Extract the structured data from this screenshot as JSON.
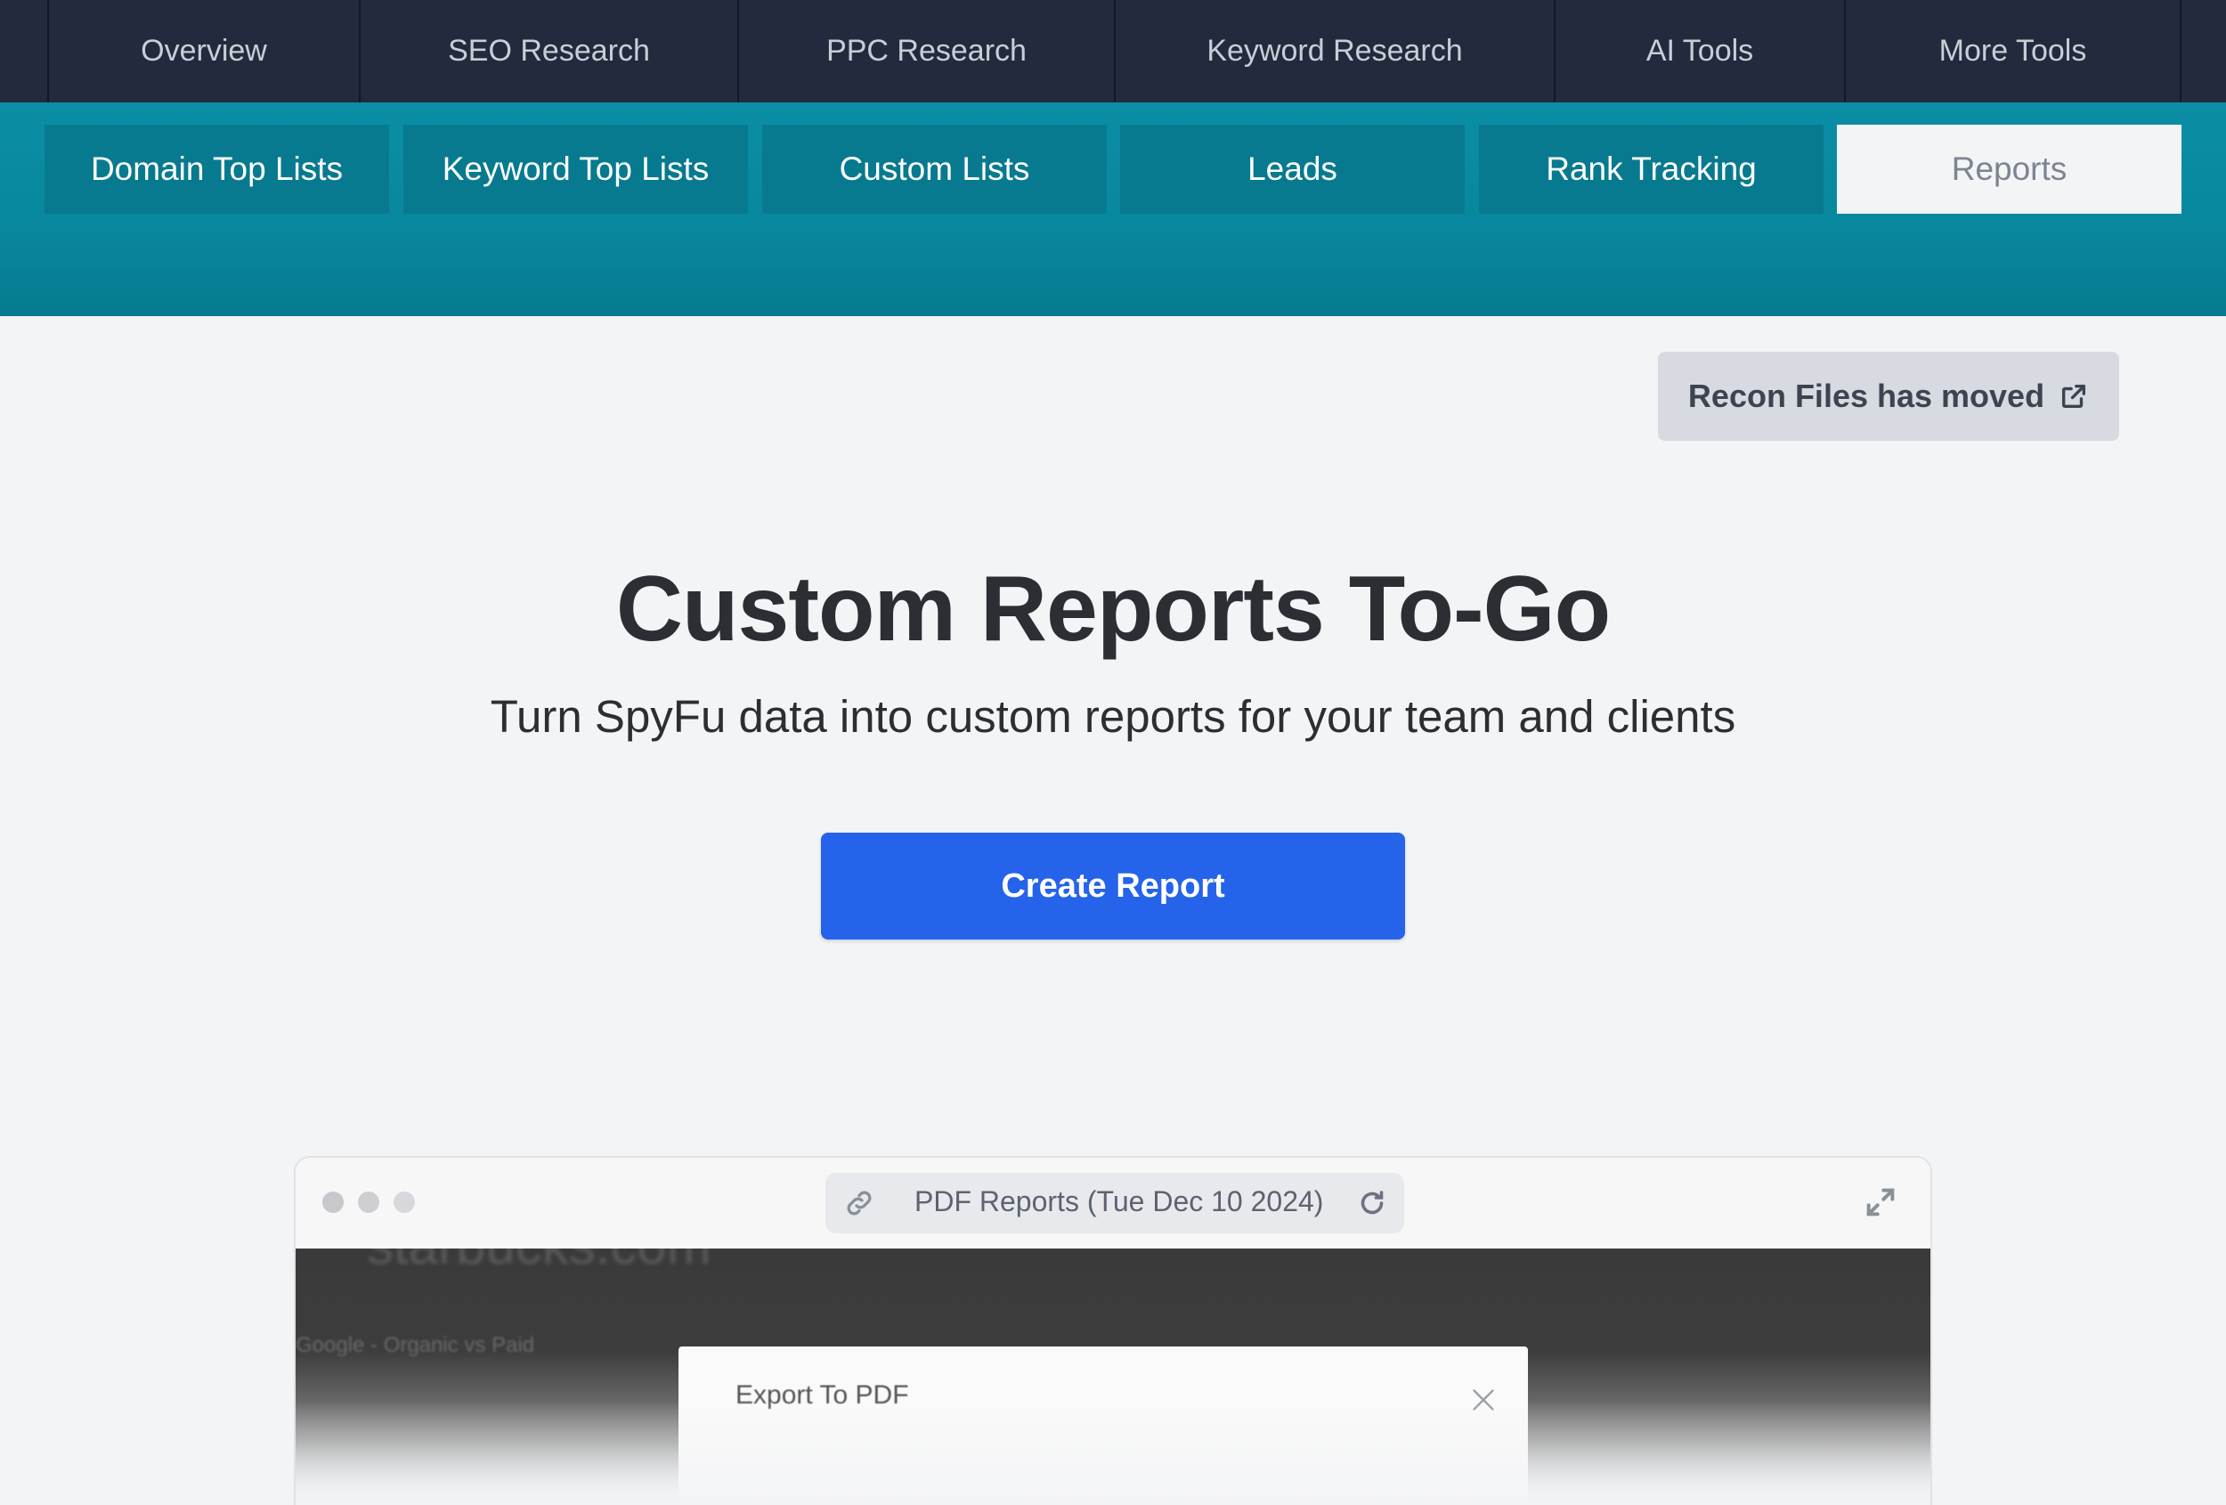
{
  "topnav": {
    "items": [
      {
        "label": "Overview"
      },
      {
        "label": "SEO Research"
      },
      {
        "label": "PPC Research"
      },
      {
        "label": "Keyword Research"
      },
      {
        "label": "AI Tools"
      },
      {
        "label": "More Tools"
      }
    ]
  },
  "subtabs": {
    "items": [
      {
        "label": "Domain Top Lists"
      },
      {
        "label": "Keyword Top Lists"
      },
      {
        "label": "Custom Lists"
      },
      {
        "label": "Leads"
      },
      {
        "label": "Rank Tracking"
      },
      {
        "label": "Reports",
        "active": true
      }
    ]
  },
  "recon": {
    "label": "Recon Files has moved",
    "icon": "external-link-icon"
  },
  "hero": {
    "title": "Custom Reports To-Go",
    "subtitle": "Turn SpyFu data into custom reports for your team and clients",
    "cta_label": "Create Report"
  },
  "mock": {
    "address": "PDF Reports (Tue Dec 10 2024)",
    "domain": "starbucks.com",
    "chart_label": "Google - Organic vs Paid",
    "modal_title": "Export To PDF"
  },
  "colors": {
    "nav_bg": "#212b3d",
    "teal": "#0b8ea5",
    "subtab_bg": "#087a8f",
    "primary": "#2563eb",
    "page_bg": "#f3f4f6"
  }
}
